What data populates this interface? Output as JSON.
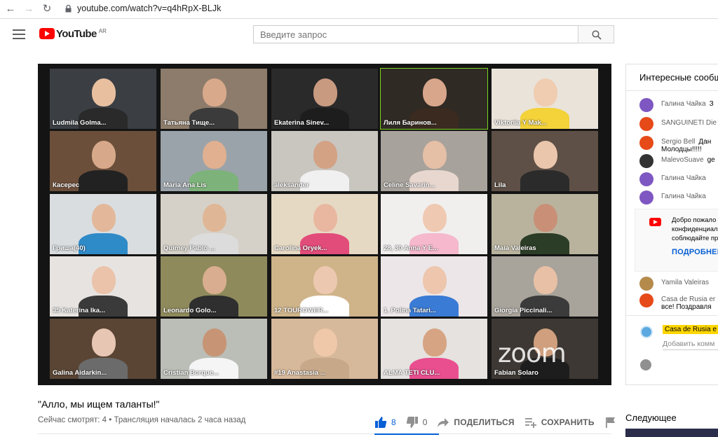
{
  "browser": {
    "url": "youtube.com/watch?v=q4hRpX-BLJk"
  },
  "masthead": {
    "logo_text": "YouTube",
    "region": "AR",
    "search_placeholder": "Введите запрос"
  },
  "video": {
    "watermark": "zoom",
    "participants": [
      {
        "name": "Ludmila Golma...",
        "bg": "#3b3f44",
        "skin": "#e8c0a0",
        "shirt": "#2a2a2a"
      },
      {
        "name": "Татьяна Тище...",
        "bg": "#8d7c6b",
        "skin": "#d9a98c",
        "shirt": "#3b3b3b"
      },
      {
        "name": "Ekaterina Sinev...",
        "bg": "#2a2a2a",
        "skin": "#c89a80",
        "shirt": "#1d1d1d"
      },
      {
        "name": "Лиля Баринов...",
        "bg": "#2f2a24",
        "skin": "#d8a68a",
        "shirt": "#3a2a20"
      },
      {
        "name": "Viktoriia Y Mak...",
        "bg": "#e9e3da",
        "skin": "#f0cdb1",
        "shirt": "#f3d23a"
      },
      {
        "name": "Касерес",
        "bg": "#6b4f3a",
        "skin": "#d7a98a",
        "shirt": "#222222"
      },
      {
        "name": "Maria Ana Lis",
        "bg": "#9aa3a9",
        "skin": "#e0b090",
        "shirt": "#7db37a"
      },
      {
        "name": "aleksander",
        "bg": "#c9c5bf",
        "skin": "#d3a184",
        "shirt": "#f0f0f0"
      },
      {
        "name": "Celine Savarin...",
        "bg": "#a7a29b",
        "skin": "#e5bfa6",
        "shirt": "#e7d7cf"
      },
      {
        "name": "Lila",
        "bg": "#5e5046",
        "skin": "#eac6ad",
        "shirt": "#2b2b2b"
      },
      {
        "name": "Гриша(40)",
        "bg": "#d9dde0",
        "skin": "#e3b89a",
        "shirt": "#2f8ac8"
      },
      {
        "name": "Quimey Pablo ...",
        "bg": "#d6d1c8",
        "skin": "#e0b796",
        "shirt": "#dcdcdc"
      },
      {
        "name": "Carolina Oryek...",
        "bg": "#e6d9c4",
        "skin": "#e9b7a0",
        "shirt": "#e24c7a"
      },
      {
        "name": "28, 30 Anna Y E...",
        "bg": "#f1eeee",
        "skin": "#efc9b1",
        "shirt": "#f5b8cc"
      },
      {
        "name": "Maia Valeiras",
        "bg": "#b9b39e",
        "skin": "#c99077",
        "shirt": "#2c3d27"
      },
      {
        "name": "35 Katerina Ika...",
        "bg": "#e7e3e0",
        "skin": "#eac3aa",
        "shirt": "#3a3a3a"
      },
      {
        "name": "Leonardo Golo...",
        "bg": "#8e8a5c",
        "skin": "#d9ad90",
        "shirt": "#2f2f2f"
      },
      {
        "name": "12 TOUROWER...",
        "bg": "#cfb48a",
        "skin": "#edc8b0",
        "shirt": "#ffffff"
      },
      {
        "name": "1. Polina Tatari...",
        "bg": "#ece6e8",
        "skin": "#edc6ad",
        "shirt": "#3a7bd5"
      },
      {
        "name": "Giorgia Piccinali...",
        "bg": "#a8a39b",
        "skin": "#e8c0a5",
        "shirt": "#3b3b3b"
      },
      {
        "name": "Galina Aidarkin...",
        "bg": "#5a4534",
        "skin": "#e7c6b3",
        "shirt": "#6b6b6b"
      },
      {
        "name": "Cristian Borque...",
        "bg": "#bbbdb7",
        "skin": "#c79575",
        "shirt": "#f5f5f5"
      },
      {
        "name": "#19 Anastasia ...",
        "bg": "#d6b89a",
        "skin": "#efc7a9",
        "shirt": "#c7a98a"
      },
      {
        "name": "ALMA TETI CLU...",
        "bg": "#e5e2df",
        "skin": "#d6a482",
        "shirt": "#e94f8f"
      },
      {
        "name": "Fabian Solaro",
        "bg": "#3d3833",
        "skin": "#cf9f7e",
        "shirt": "#1d1d1d"
      }
    ]
  },
  "below": {
    "title": "\"Алло, мы ищем таланты!\"",
    "meta": "Сейчас смотрят: 4 • Трансляция началась 2 часа назад",
    "likes": "8",
    "dislikes": "0",
    "share_label": "ПОДЕЛИТЬСЯ",
    "save_label": "СОХРАНИТЬ"
  },
  "chat": {
    "header": "Интересные сообщ",
    "messages": [
      {
        "author": "Галина Чайка",
        "text": "З",
        "color": "#7e57c2"
      },
      {
        "author": "SANGUINETI Die",
        "text": "",
        "color": "#e64a19"
      },
      {
        "author": "Sergio Bell",
        "text": "Дан",
        "line2": "Молодцы!!!!!",
        "color": "#e64a19"
      },
      {
        "author": "MalevoSuave",
        "text": "ge",
        "color": "#333333"
      },
      {
        "author": "Галина Чайка",
        "text": "",
        "color": "#7e57c2"
      },
      {
        "author": "Галина Чайка",
        "text": "",
        "color": "#7e57c2"
      },
      {
        "author": "Yamila Valeiras",
        "text": "",
        "color": "#b58b4c"
      },
      {
        "author": "Casa de Rusia er",
        "text": "",
        "line2": "все! Поздравля",
        "color": "#e64a19"
      }
    ],
    "pinned": {
      "lines": [
        "Добро пожало",
        "конфиденциал",
        "соблюдайте пр"
      ],
      "more": "ПОДРОБНЕЕ"
    },
    "input": {
      "user": "Casa de Rusia e",
      "placeholder": "Добавить комм"
    }
  },
  "up_next": {
    "label": "Следующее"
  }
}
